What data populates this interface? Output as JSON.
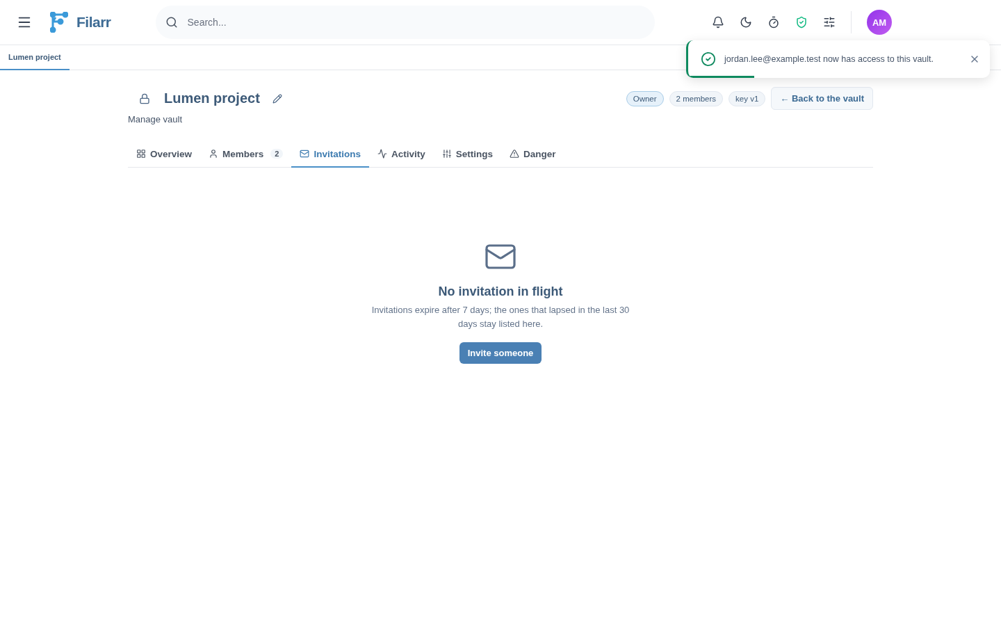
{
  "header": {
    "brand": "Filarr",
    "search": {
      "placeholder": "Search..."
    },
    "actions": [
      {
        "kind": "bell"
      },
      {
        "kind": "moon"
      },
      {
        "kind": "timer"
      },
      {
        "kind": "shield"
      },
      {
        "kind": "sliders"
      }
    ],
    "avatar": "AM"
  },
  "doc_tabs": [
    {
      "label": "Lumen project",
      "selected": true
    }
  ],
  "toast": {
    "message": "jordan.lee@example.test now has access to this vault.",
    "level": 0.22
  },
  "vault": {
    "title": "Lumen project",
    "subtitle": "Manage vault",
    "badges": [
      {
        "label": "Owner",
        "selected": true
      },
      {
        "label": "2 members",
        "selected": false
      },
      {
        "label": "key v1",
        "selected": false
      }
    ],
    "back": "← Back to the vault",
    "tabs": [
      {
        "kind": "grid",
        "label": "Overview",
        "selected": false
      },
      {
        "kind": "user",
        "label": "Members",
        "count": "2",
        "selected": false
      },
      {
        "kind": "mail",
        "label": "Invitations",
        "selected": true
      },
      {
        "kind": "activity",
        "label": "Activity",
        "selected": false
      },
      {
        "kind": "sliders",
        "label": "Settings",
        "selected": false
      },
      {
        "kind": "warning",
        "label": "Danger",
        "selected": false
      }
    ]
  },
  "empty": {
    "title": "No invitation in flight",
    "text": "Invitations expire after 7 days; the ones that lapsed in the last 30 days stay listed here.",
    "button": "Invite someone"
  }
}
